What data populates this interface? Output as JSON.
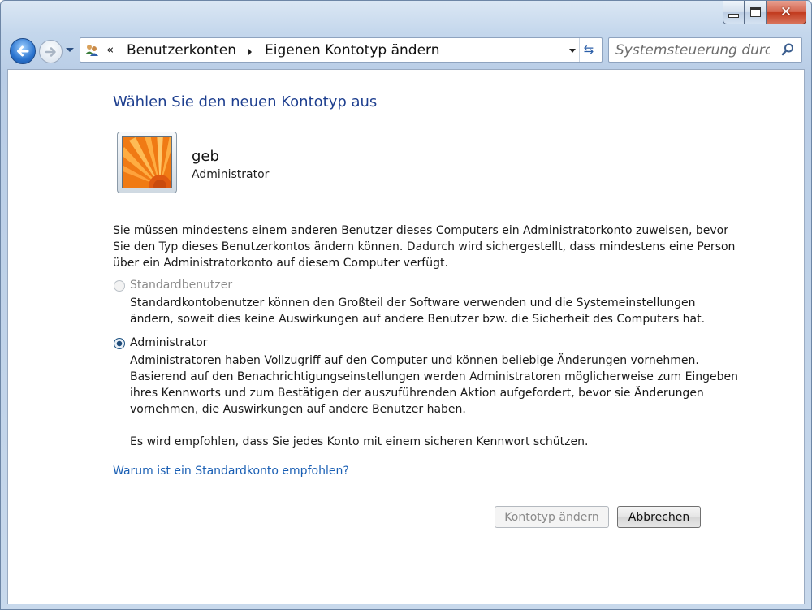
{
  "window": {
    "minimize_icon": "minimize-icon",
    "maximize_icon": "maximize-icon",
    "close_icon": "close-icon",
    "close_glyph": "✕"
  },
  "nav": {
    "back_icon": "back-arrow-icon",
    "forward_icon": "forward-arrow-icon"
  },
  "address": {
    "chevron": "«",
    "crumbs": [
      "Benutzerkonten",
      "Eigenen Kontotyp ändern"
    ],
    "refresh_glyph": "⇆"
  },
  "search": {
    "placeholder": "Systemsteuerung durc..."
  },
  "main": {
    "title": "Wählen Sie den neuen Kontotyp aus",
    "user": {
      "name": "geb",
      "type": "Administrator"
    },
    "info_lines": [
      "Sie müssen mindestens einem anderen Benutzer dieses Computers ein Administratorkonto zuweisen, bevor",
      "Sie den Typ dieses Benutzerkontos ändern können. Dadurch wird sichergestellt, dass mindestens eine Person",
      "über ein Administratorkonto auf diesem Computer verfügt."
    ],
    "options": [
      {
        "label": "Standardbenutzer",
        "selected": false,
        "enabled": false,
        "desc": [
          "Standardkontobenutzer können den Großteil der Software verwenden und die Systemeinstellungen",
          "ändern, soweit dies keine Auswirkungen auf andere Benutzer bzw. die Sicherheit des Computers hat."
        ]
      },
      {
        "label": "Administrator",
        "selected": true,
        "enabled": true,
        "desc": [
          "Administratoren haben Vollzugriff auf den Computer und können beliebige Änderungen vornehmen.",
          "Basierend auf den Benachrichtigungseinstellungen werden Administratoren möglicherweise zum Eingeben",
          "ihres Kennworts und zum Bestätigen der auszuführenden Aktion aufgefordert, bevor sie Änderungen",
          "vornehmen, die Auswirkungen auf andere Benutzer haben.",
          "",
          "Es wird empfohlen, dass Sie jedes Konto mit einem sicheren Kennwort schützen."
        ]
      }
    ],
    "help_link": "Warum ist ein Standardkonto empfohlen?",
    "buttons": {
      "change": "Kontotyp ändern",
      "cancel": "Abbrechen"
    }
  },
  "colors": {
    "title": "#1e3f8f",
    "link": "#1a5fb4",
    "close_button": "#c1391c"
  }
}
